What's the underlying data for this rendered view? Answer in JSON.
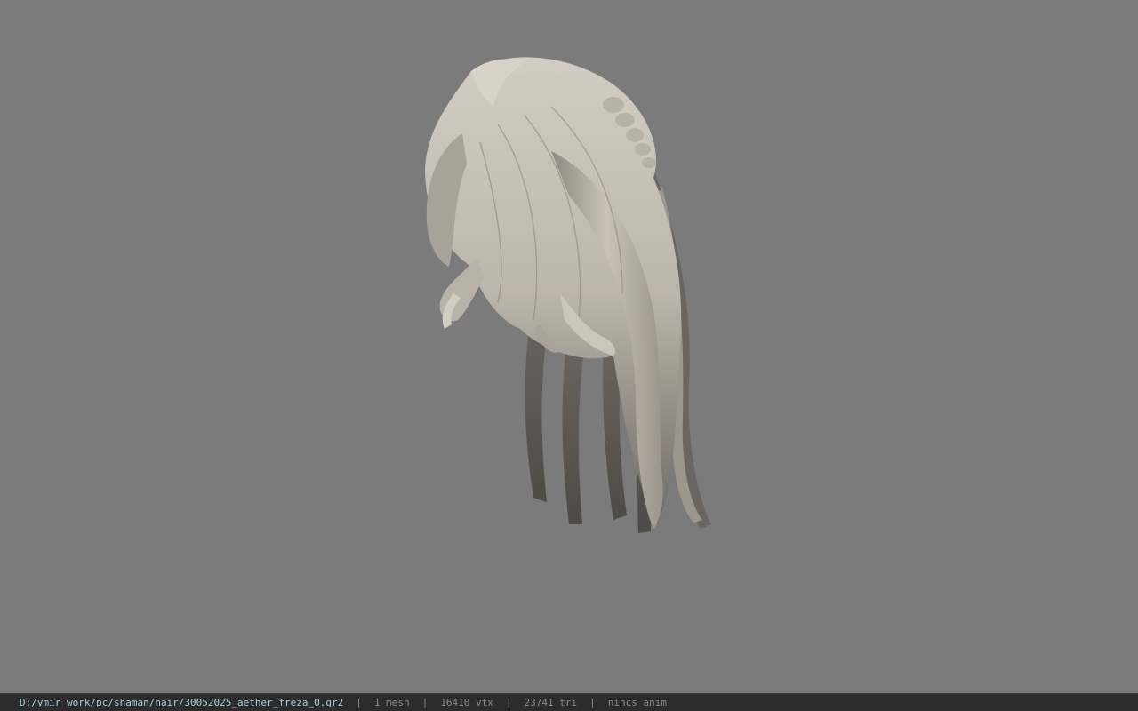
{
  "viewport": {
    "background_color": "#7b7b7b",
    "model_color": "#c4beb5",
    "model_name": "hair-mesh"
  },
  "statusbar": {
    "file_path": "D:/ymir work/pc/shaman/hair/30052025_aether_freza_0.gr2",
    "separator": "|",
    "mesh_count": "1 mesh",
    "vertex_count": "16410 vtx",
    "triangle_count": "23741 tri",
    "animation_status": "nincs anim",
    "path_color": "#a9cdd9",
    "text_color": "#8a8a8a"
  }
}
